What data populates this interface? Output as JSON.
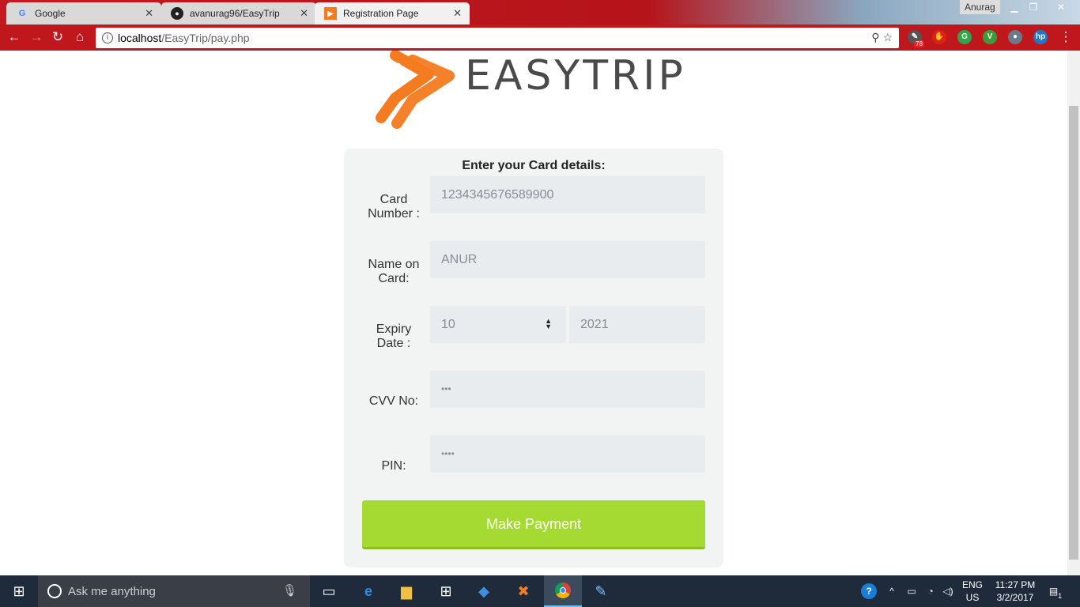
{
  "browser": {
    "tabs": [
      {
        "label": "Google",
        "icon": "google-icon"
      },
      {
        "label": "avanurag96/EasyTrip",
        "icon": "github-icon"
      },
      {
        "label": "Registration Page",
        "icon": "easytrip-favicon"
      }
    ],
    "user": "Anurag",
    "url_host": "localhost",
    "url_path": "/EasyTrip/pay.php",
    "extension_badge": "78"
  },
  "page": {
    "logo_text": "EASYTRIP",
    "form_title": "Enter your Card details:",
    "fields": {
      "card_number_label_1": "Card",
      "card_number_label_2": "Number :",
      "card_number_value": "1234345676589900",
      "name_label_1": "Name on",
      "name_label_2": "Card:",
      "name_value": "ANUR",
      "expiry_label_1": "Expiry",
      "expiry_label_2": "Date :",
      "expiry_month": "10",
      "expiry_year": "2021",
      "cvv_label": "CVV No:",
      "cvv_value": "•••",
      "pin_label": "PIN:",
      "pin_value": "••••"
    },
    "pay_button": "Make Payment"
  },
  "taskbar": {
    "search_placeholder": "Ask me anything",
    "lang_1": "ENG",
    "lang_2": "US",
    "time": "11:27 PM",
    "date": "3/2/2017",
    "notification_count": "1"
  },
  "colors": {
    "brand_red": "#c0171d",
    "accent_orange": "#f47b20",
    "pay_green": "#a5da32"
  }
}
